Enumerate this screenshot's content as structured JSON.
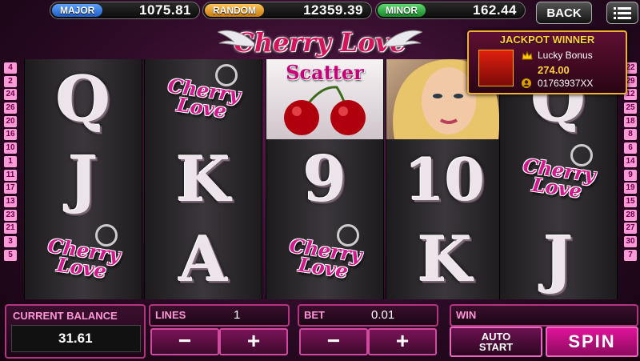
{
  "jackpots": {
    "major": {
      "label": "MAJOR",
      "value": "1075.81",
      "color": "#2a6fd6"
    },
    "random": {
      "label": "RANDOM",
      "value": "12359.39",
      "color": "#d68a1b"
    },
    "minor": {
      "label": "MINOR",
      "value": "162.44",
      "color": "#1fa03a"
    }
  },
  "nav": {
    "back_label": "BACK",
    "menu_icon": "menu-icon"
  },
  "logo": {
    "text": "Cherry Love"
  },
  "reels": [
    [
      "Q",
      "J",
      "cherry-love"
    ],
    [
      "cherry-love",
      "K",
      "A"
    ],
    [
      "scatter",
      "9",
      "cherry-love"
    ],
    [
      "portrait",
      "10",
      "K"
    ],
    [
      "Q",
      "cherry-love",
      "J"
    ]
  ],
  "symbols": {
    "cherry_love_line1": "Cherry",
    "cherry_love_line2": "Love",
    "scatter_label": "Scatter"
  },
  "left_lines": [
    "4",
    "2",
    "24",
    "26",
    "20",
    "16",
    "10",
    "1",
    "11",
    "17",
    "13",
    "23",
    "21",
    "3",
    "5"
  ],
  "right_lines": [
    "22",
    "29",
    "12",
    "25",
    "18",
    "8",
    "6",
    "14",
    "9",
    "19",
    "15",
    "28",
    "27",
    "30",
    "7"
  ],
  "jackpot_winner": {
    "title": "JACKPOT WINNER",
    "prize_name": "Lucky Bonus",
    "amount": "274.00",
    "player": "01763937XX"
  },
  "balance": {
    "label": "CURRENT BALANCE",
    "value": "31.61"
  },
  "lines": {
    "label": "LINES",
    "value": "1",
    "minus": "−",
    "plus": "+"
  },
  "bet": {
    "label": "BET",
    "value": "0.01",
    "minus": "−",
    "plus": "+"
  },
  "win": {
    "label": "WIN",
    "value": ""
  },
  "buttons": {
    "auto_line1": "AUTO",
    "auto_line2": "START",
    "spin": "SPIN"
  },
  "colors": {
    "accent": "#d4145a",
    "panel_border": "#b1357f",
    "gold": "#ffd23a"
  }
}
